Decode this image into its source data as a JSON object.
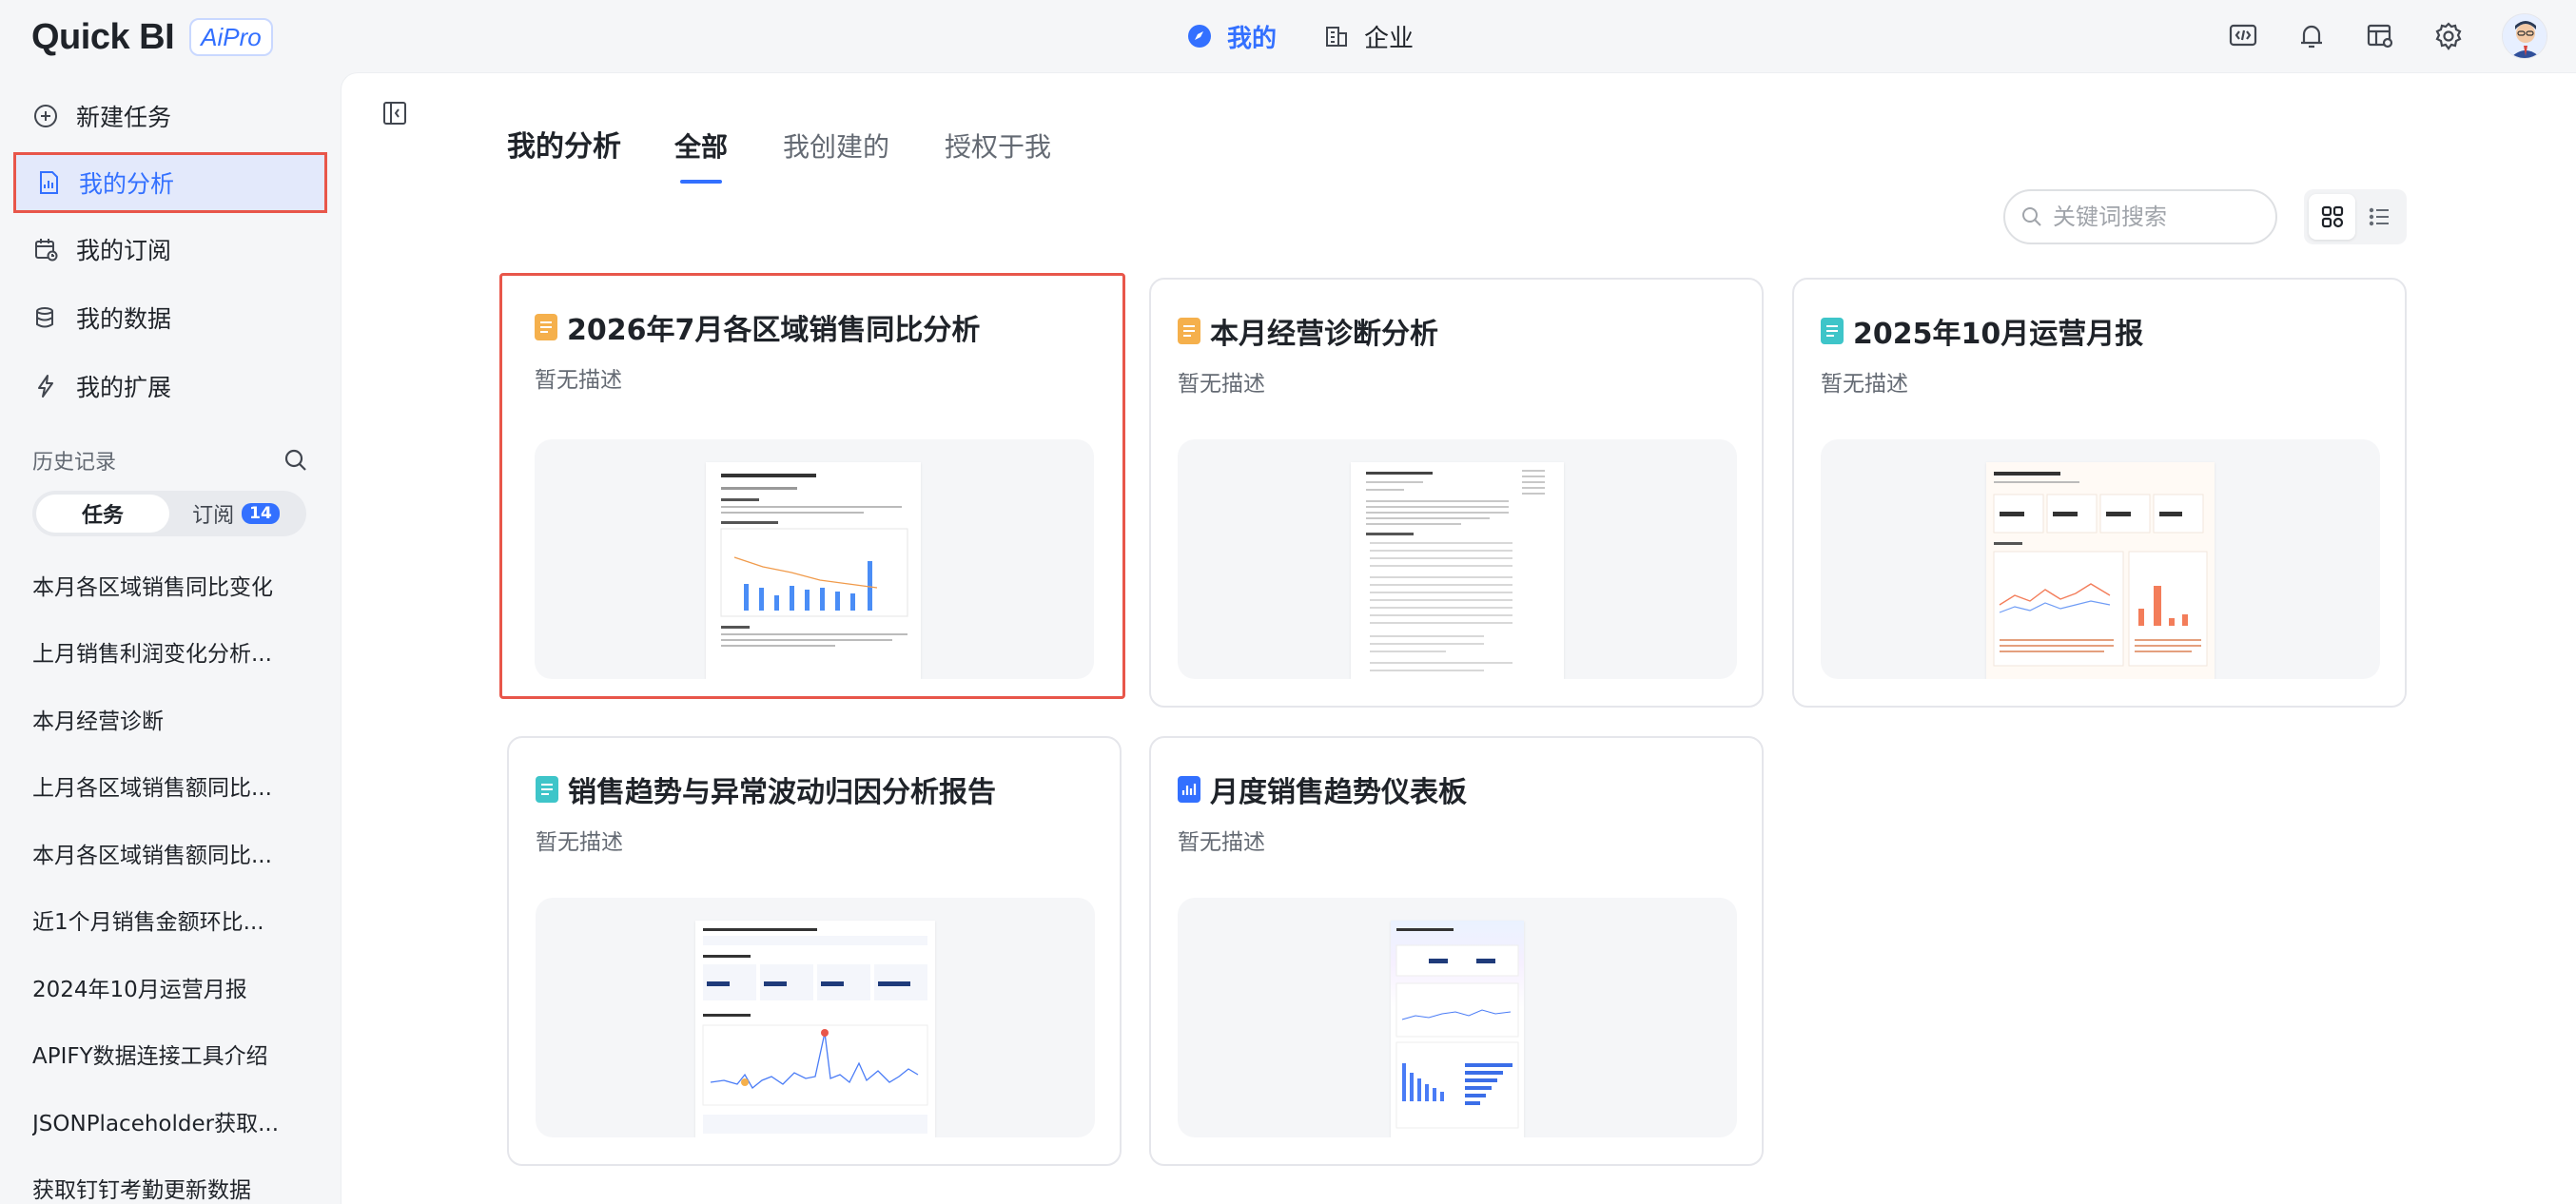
{
  "brand": {
    "name": "Quick BI",
    "badge": "AiPro"
  },
  "top_tabs": [
    {
      "label": "我的",
      "icon": "compass-icon",
      "active": true
    },
    {
      "label": "企业",
      "icon": "building-icon",
      "active": false
    }
  ],
  "top_icons": [
    "code-window-icon",
    "bell-icon",
    "table-settings-icon",
    "gear-icon",
    "user-avatar"
  ],
  "sidebar": {
    "nav": [
      {
        "label": "新建任务",
        "icon": "plus-circle-icon",
        "active": false
      },
      {
        "label": "我的分析",
        "icon": "analysis-doc-icon",
        "active": true
      },
      {
        "label": "我的订阅",
        "icon": "calendar-subscribe-icon",
        "active": false
      },
      {
        "label": "我的数据",
        "icon": "database-icon",
        "active": false
      },
      {
        "label": "我的扩展",
        "icon": "lightning-icon",
        "active": false
      }
    ],
    "history_label": "历史记录",
    "segment": {
      "task": "任务",
      "subscribe": "订阅",
      "subscribe_count": "14"
    },
    "history": [
      "本月各区域销售同比变化",
      "上月销售利润变化分析...",
      "本月经营诊断",
      "上月各区域销售额同比...",
      "本月各区域销售额同比...",
      "近1个月销售金额环比...",
      "2024年10月运营月报",
      "APIFY数据连接工具介绍",
      "JSONPlaceholder获取...",
      "获取钉钉考勤更新数据"
    ]
  },
  "main": {
    "title": "我的分析",
    "filter_tabs": [
      "全部",
      "我创建的",
      "授权于我"
    ],
    "active_filter": 0,
    "search_placeholder": "关键词搜索",
    "view_modes": [
      "grid-view-icon",
      "list-view-icon"
    ],
    "cards": [
      {
        "title": "2026年7月各区域销售同比分析",
        "desc": "暂无描述",
        "icon_color": "#f5b04c",
        "highlighted": true
      },
      {
        "title": "本月经营诊断分析",
        "desc": "暂无描述",
        "icon_color": "#f5b04c",
        "highlighted": false
      },
      {
        "title": "2025年10月运营月报",
        "desc": "暂无描述",
        "icon_color": "#3ec5c9",
        "highlighted": false
      },
      {
        "title": "销售趋势与异常波动归因分析报告",
        "desc": "暂无描述",
        "icon_color": "#3ec5c9",
        "highlighted": false
      },
      {
        "title": "月度销售趋势仪表板",
        "desc": "暂无描述",
        "icon_color": "#3370ff",
        "highlighted": false
      }
    ]
  },
  "colors": {
    "accent": "#3370ff",
    "highlight_border": "#e8564a"
  }
}
